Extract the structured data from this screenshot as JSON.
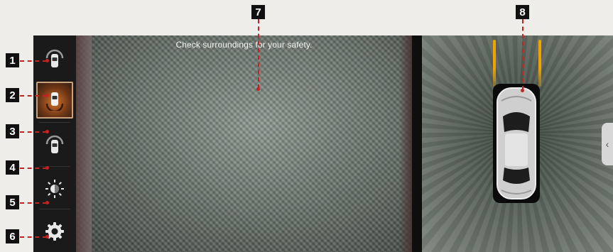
{
  "camera_view": {
    "message": "Check surroundings for your safety."
  },
  "sidebar": {
    "items": [
      {
        "icon": "rear-camera-view-icon",
        "selected": false
      },
      {
        "icon": "rear-camera-view-icon",
        "selected": true
      },
      {
        "icon": "rear-camera-view-icon",
        "selected": false
      },
      {
        "icon": "brightness-icon",
        "selected": false
      },
      {
        "icon": "gear-icon",
        "selected": false
      }
    ]
  },
  "callouts": [
    "1",
    "2",
    "3",
    "4",
    "5",
    "6",
    "7",
    "8"
  ],
  "colors": {
    "callout_line": "#c42323",
    "guide_line": "#f0a400",
    "selected_button": "#d2742a"
  }
}
